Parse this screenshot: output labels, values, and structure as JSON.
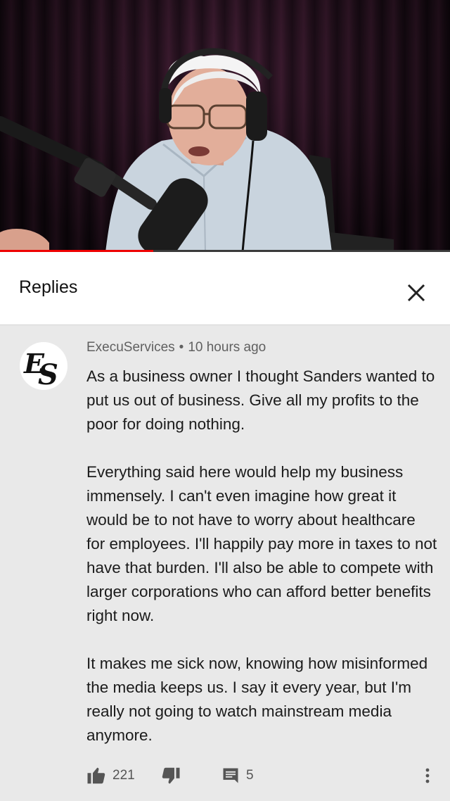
{
  "video": {
    "progress": 0.34,
    "accent": "#ee0000"
  },
  "header": {
    "title": "Replies",
    "close_icon": "close-icon"
  },
  "comment": {
    "avatar_logo": "ES",
    "author": "ExecuServices",
    "separator": "•",
    "time": "10 hours ago",
    "paragraphs": [
      "As a business owner I thought Sanders wanted to put us out of business. Give all my profits to the poor for doing nothing.",
      "Everything said here would help my business immensely. I can't even imagine how great it would be to not have to worry about healthcare for employees. I'll happily pay more in taxes to not have that burden. I'll also be able to compete with larger corporations who can afford better benefits right now.",
      "It makes me sick now, knowing how misinformed the media keeps us. I say it every year, but I'm really not going to watch mainstream media anymore."
    ],
    "likes": "221",
    "replies": "5",
    "icons": [
      "thumbs-up-icon",
      "thumbs-down-icon",
      "comment-icon",
      "more-vert-icon"
    ]
  }
}
